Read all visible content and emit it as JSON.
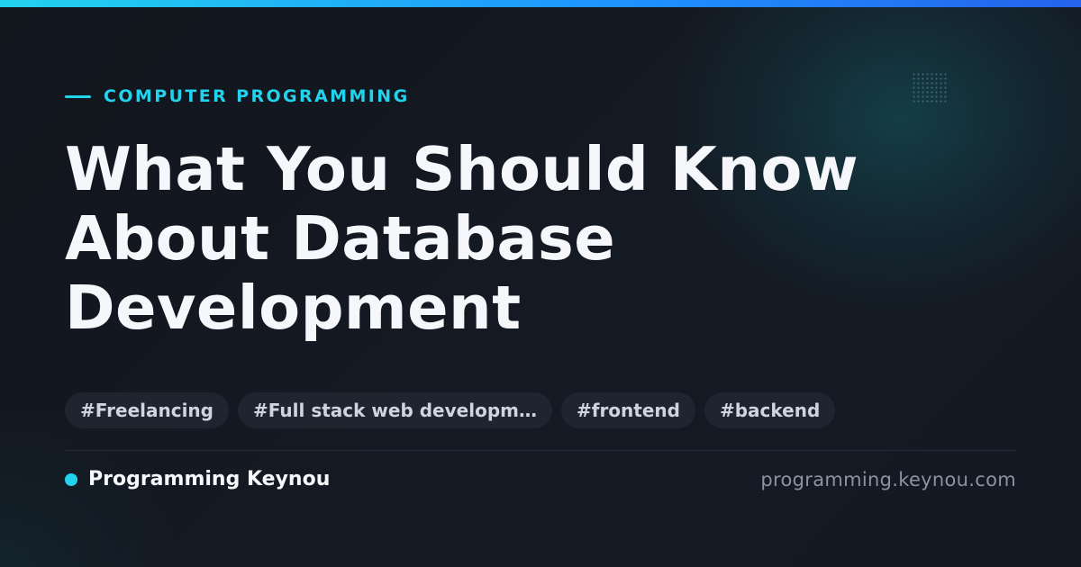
{
  "category": "COMPUTER PROGRAMMING",
  "title": "What You Should Know About Database Development",
  "tags": [
    "#Freelancing",
    "#Full stack web developm…",
    "#frontend",
    "#backend"
  ],
  "brand": "Programming Keynou",
  "site": "programming.keynou.com",
  "colors": {
    "accent": "#22d3ee",
    "background": "#12161f",
    "tag_background": "#1f2530",
    "title": "#f5f7fb",
    "muted": "#8a93a2"
  }
}
